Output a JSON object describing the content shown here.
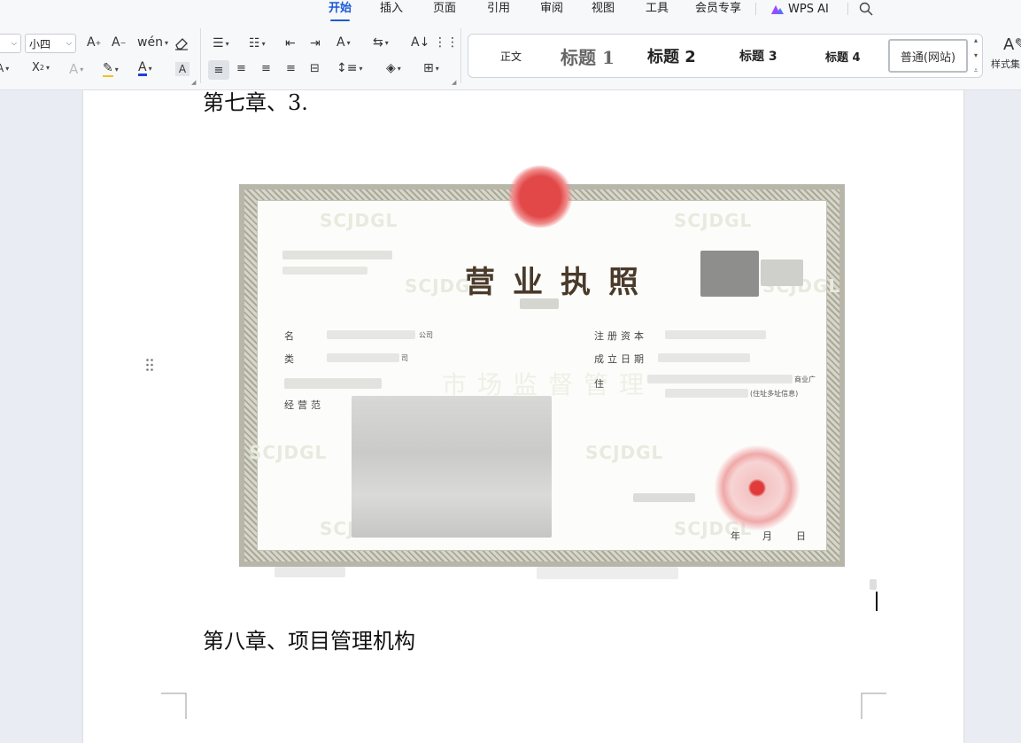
{
  "menu": {
    "tabs": [
      "开始",
      "插入",
      "页面",
      "引用",
      "审阅",
      "视图",
      "工具",
      "会员专享"
    ],
    "active_tab": "开始",
    "ai_label": "WPS AI"
  },
  "ribbon": {
    "font_size": "小四",
    "styles": {
      "normal": "正文",
      "h1": "标题 1",
      "h2": "标题 2",
      "h3": "标题 3",
      "h4": "标题 4",
      "selected": "普通(网站)"
    },
    "style_set_label": "样式集"
  },
  "document": {
    "heading_top": "第七章、3.",
    "heading_bottom": "第八章、项目管理机构"
  },
  "certificate": {
    "title": "营业执照",
    "watermark_text": "SCJDGL",
    "big_watermark": "市场监督管理",
    "fields_left": [
      "名",
      "类",
      "经营范"
    ],
    "fields_right": [
      "注册资本",
      "成立日期",
      "住"
    ],
    "company_fragment_1": "公司",
    "company_fragment_2": "司",
    "address_fragment_1": "商业广",
    "address_fragment_2": "(住址多址信息)",
    "date_labels": [
      "年",
      "月",
      "日"
    ]
  },
  "colors": {
    "accent": "#1a5ad7",
    "seal_red": "#e03a3a",
    "page_bg": "#ffffff",
    "workspace_bg": "#e9ecf2"
  }
}
